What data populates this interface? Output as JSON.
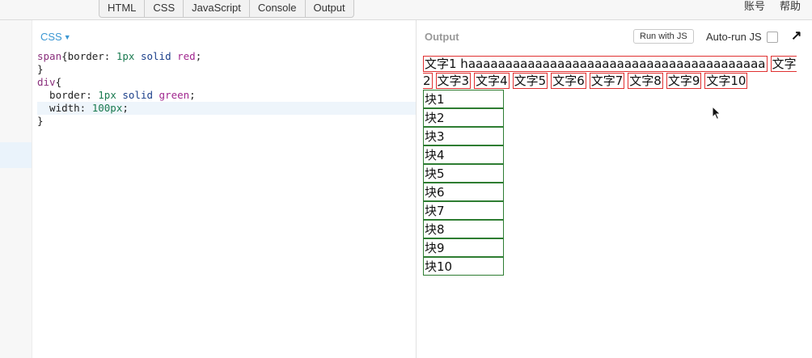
{
  "tabs": [
    "HTML",
    "CSS",
    "JavaScript",
    "Console",
    "Output"
  ],
  "top_links": [
    "账号",
    "帮助"
  ],
  "editor": {
    "language": "CSS",
    "code": {
      "l1_selector": "span",
      "l1_open": "{",
      "l1_prop": "border: ",
      "l1_num": "1px",
      "l1_kw": " solid ",
      "l1_val": "red",
      "l1_end": ";",
      "l2": "}",
      "l3_selector": "div",
      "l3_open": "{",
      "l4_prop": "  border: ",
      "l4_num": "1px",
      "l4_kw": " solid ",
      "l4_val": "green",
      "l4_end": ";",
      "l5_prop": "  width: ",
      "l5_num": "100px",
      "l5_end": ";",
      "l6": "}"
    }
  },
  "output": {
    "label": "Output",
    "run_button": "Run with JS",
    "autorun_label": "Auto-run JS",
    "autorun_checked": false,
    "spans": [
      "文字1 haaaaaaaaaaaaaaaaaaaaaaaaaaaaaaaaaaaaaaaa",
      "文字2",
      "文字3",
      "文字4",
      "文字5",
      "文字6",
      "文字7",
      "文字8",
      "文字9",
      "文字10"
    ],
    "blocks": [
      "块1",
      "块2",
      "块3",
      "块4",
      "块5",
      "块6",
      "块7",
      "块8",
      "块9",
      "块10"
    ]
  },
  "colors": {
    "span_border": "#e03131",
    "div_border": "#2e7d32",
    "accent": "#3b97d3"
  },
  "icons": {
    "expand": "expand-icon",
    "caret": "chevron-down-icon",
    "cursor": "mouse-cursor-icon"
  }
}
